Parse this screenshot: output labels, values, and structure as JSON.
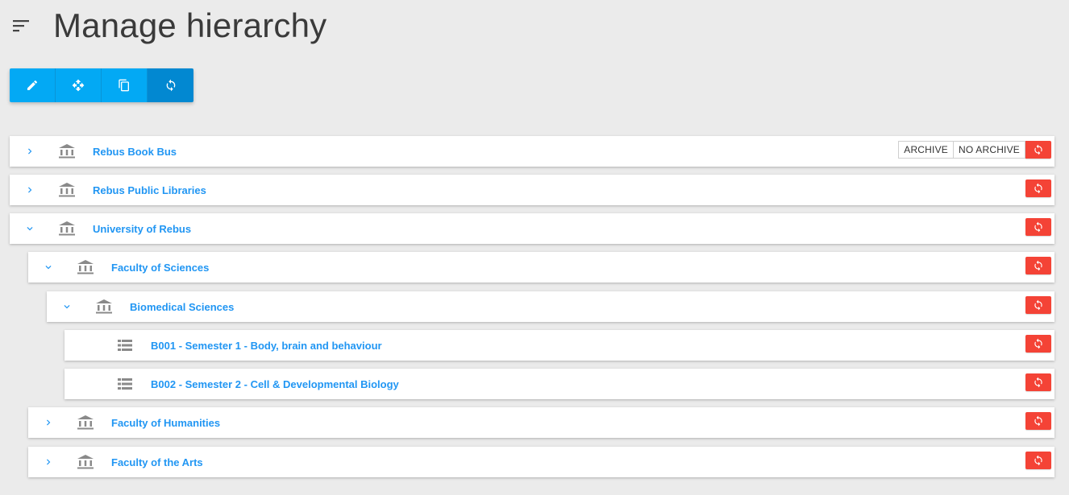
{
  "header": {
    "title": "Manage hierarchy",
    "menu_icon": "sort-menu-icon"
  },
  "toolbar": {
    "buttons": [
      {
        "icon": "pencil-icon",
        "active": false
      },
      {
        "icon": "move-arrows-icon",
        "active": false
      },
      {
        "icon": "copy-icon",
        "active": false
      },
      {
        "icon": "sync-icon",
        "active": true
      }
    ],
    "accent_color": "#03a9f4",
    "active_color": "#0288d1"
  },
  "archive_options": {
    "archive": "ARCHIVE",
    "no_archive": "NO ARCHIVE"
  },
  "sync_color": "#f44336",
  "tree": [
    {
      "label": "Rebus Book Bus",
      "type": "institution",
      "expanded": false,
      "level": 0
    },
    {
      "label": "Rebus Public Libraries",
      "type": "institution",
      "expanded": false,
      "level": 0
    },
    {
      "label": "University of Rebus",
      "type": "institution",
      "expanded": true,
      "level": 0
    },
    {
      "label": "Faculty of Sciences",
      "type": "institution",
      "expanded": true,
      "level": 1
    },
    {
      "label": "Biomedical Sciences",
      "type": "institution",
      "expanded": true,
      "level": 2
    },
    {
      "label": "B001 - Semester 1 - Body, brain and behaviour",
      "type": "list",
      "level": 3
    },
    {
      "label": "B002 - Semester 2 - Cell & Developmental Biology",
      "type": "list",
      "level": 3
    },
    {
      "label": "Faculty of Humanities",
      "type": "institution",
      "expanded": false,
      "level": 1
    },
    {
      "label": "Faculty of the Arts",
      "type": "institution",
      "expanded": false,
      "level": 1
    }
  ]
}
